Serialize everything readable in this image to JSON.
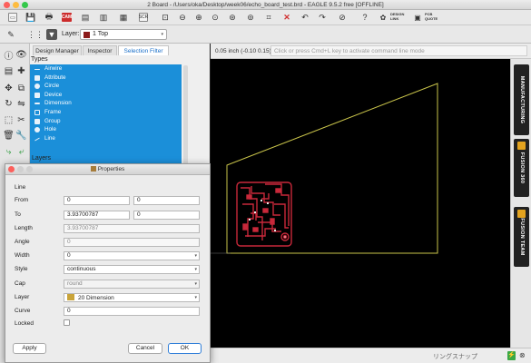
{
  "window": {
    "title": "2 Board - /Users/oka/Desktop/week06/echo_board_test.brd - EAGLE 9.5.2 free [OFFLINE]"
  },
  "toolbar": {
    "design_link": "DESIGN LINK",
    "pcb_quote": "PCB QUOTE",
    "sch_label": "SCH",
    "ulp_label": "ULP",
    "layer_label": "Layer:",
    "layer_value": "1 Top",
    "layer_color": "#8b1a1a"
  },
  "panel": {
    "tabs": [
      "Design Manager",
      "Inspector",
      "Selection Filter"
    ],
    "types_label": "Types",
    "types": [
      "Airwire",
      "Attribute",
      "Circle",
      "Device",
      "Dimension",
      "Frame",
      "Group",
      "Hole",
      "Line"
    ],
    "layers_label": "Layers"
  },
  "coord": {
    "readout": "0.05 inch (-0.10 0.15)",
    "command_placeholder": "Click or press Cmd+L key to activate command line mode"
  },
  "right_tabs": [
    "MANUFACTURING",
    "FUSION 360",
    "FUSION TEAM"
  ],
  "status": {
    "text": "リングスナップ"
  },
  "dialog": {
    "title": "Properties",
    "section": "Line",
    "labels": {
      "from": "From",
      "to": "To",
      "length": "Length",
      "angle": "Angle",
      "width": "Width",
      "style": "Style",
      "cap": "Cap",
      "layer": "Layer",
      "curve": "Curve",
      "locked": "Locked"
    },
    "from_x": "0",
    "from_y": "0",
    "to_x": "3.93700787",
    "to_y": "0",
    "length": "3.93700787",
    "angle": "0",
    "width": "0",
    "style": "continuous",
    "cap": "round",
    "layer": "20 Dimension",
    "layer_color": "#c9a43a",
    "curve": "0",
    "apply": "Apply",
    "cancel": "Cancel",
    "ok": "OK"
  },
  "colors": {
    "selection": "#1b8fd9",
    "board_outline": "#c8c34a",
    "copper": "#c8283a"
  }
}
